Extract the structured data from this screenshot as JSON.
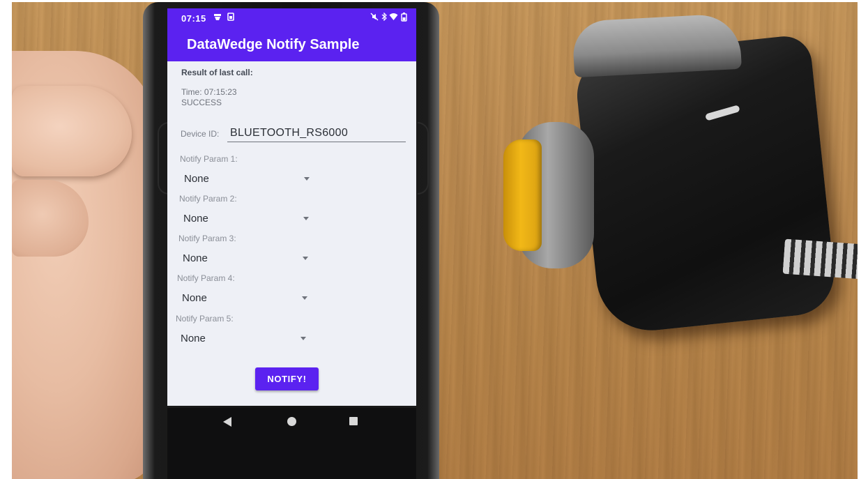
{
  "status_bar": {
    "time": "07:15",
    "left_icons": [
      "notification-icon",
      "sim-icon"
    ],
    "right_icons": [
      "mute-icon",
      "bluetooth-icon",
      "wifi-icon",
      "battery-icon"
    ]
  },
  "app": {
    "title": "DataWedge Notify Sample",
    "accent_color": "#5b22f0"
  },
  "result": {
    "label": "Result of last call:",
    "time": "Time: 07:15:23",
    "status": "SUCCESS"
  },
  "device": {
    "label": "Device ID:",
    "value": "BLUETOOTH_RS6000"
  },
  "notify_params": [
    {
      "label": "Notify Param 1:",
      "value": "None"
    },
    {
      "label": "Notify Param 2:",
      "value": "None"
    },
    {
      "label": "Notify Param 3:",
      "value": "None"
    },
    {
      "label": "Notify Param 4:",
      "value": "None"
    },
    {
      "label": "Notify Param 5:",
      "value": "None"
    }
  ],
  "notify_button": {
    "label": "NOTIFY!"
  },
  "nav_bar": {
    "icons": [
      "back-icon",
      "home-icon",
      "recent-apps-icon"
    ]
  }
}
